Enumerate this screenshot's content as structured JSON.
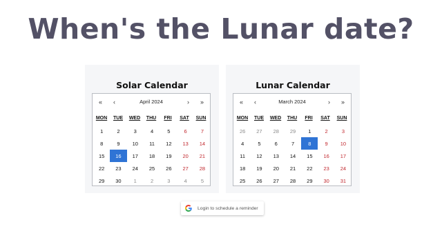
{
  "page": {
    "title": "When's the Lunar date?"
  },
  "solar": {
    "title": "Solar Calendar",
    "month_label": "April 2024",
    "nav": [
      "«",
      "‹",
      "›",
      "»"
    ],
    "weekdays": [
      "MON",
      "TUE",
      "WED",
      "THU",
      "FRI",
      "SAT",
      "SUN"
    ],
    "days": [
      {
        "t": "1",
        "s": ""
      },
      {
        "t": "2",
        "s": ""
      },
      {
        "t": "3",
        "s": ""
      },
      {
        "t": "4",
        "s": ""
      },
      {
        "t": "5",
        "s": ""
      },
      {
        "t": "6",
        "s": "we"
      },
      {
        "t": "7",
        "s": "we"
      },
      {
        "t": "8",
        "s": ""
      },
      {
        "t": "9",
        "s": ""
      },
      {
        "t": "10",
        "s": ""
      },
      {
        "t": "11",
        "s": ""
      },
      {
        "t": "12",
        "s": ""
      },
      {
        "t": "13",
        "s": "we"
      },
      {
        "t": "14",
        "s": "we"
      },
      {
        "t": "15",
        "s": ""
      },
      {
        "t": "16",
        "s": "today"
      },
      {
        "t": "17",
        "s": ""
      },
      {
        "t": "18",
        "s": ""
      },
      {
        "t": "19",
        "s": ""
      },
      {
        "t": "20",
        "s": "we"
      },
      {
        "t": "21",
        "s": "we"
      },
      {
        "t": "22",
        "s": ""
      },
      {
        "t": "23",
        "s": ""
      },
      {
        "t": "24",
        "s": ""
      },
      {
        "t": "25",
        "s": ""
      },
      {
        "t": "26",
        "s": ""
      },
      {
        "t": "27",
        "s": "we"
      },
      {
        "t": "28",
        "s": "we"
      },
      {
        "t": "29",
        "s": ""
      },
      {
        "t": "30",
        "s": ""
      },
      {
        "t": "1",
        "s": "out"
      },
      {
        "t": "2",
        "s": "out"
      },
      {
        "t": "3",
        "s": "out"
      },
      {
        "t": "4",
        "s": "out"
      },
      {
        "t": "5",
        "s": "out"
      }
    ]
  },
  "lunar": {
    "title": "Lunar Calendar",
    "month_label": "March 2024",
    "nav": [
      "«",
      "‹",
      "›",
      "»"
    ],
    "weekdays": [
      "MON",
      "TUE",
      "WED",
      "THU",
      "FRI",
      "SAT",
      "SUN"
    ],
    "days": [
      {
        "t": "26",
        "s": "out"
      },
      {
        "t": "27",
        "s": "out"
      },
      {
        "t": "28",
        "s": "out"
      },
      {
        "t": "29",
        "s": "out"
      },
      {
        "t": "1",
        "s": ""
      },
      {
        "t": "2",
        "s": "we"
      },
      {
        "t": "3",
        "s": "we"
      },
      {
        "t": "4",
        "s": ""
      },
      {
        "t": "5",
        "s": ""
      },
      {
        "t": "6",
        "s": ""
      },
      {
        "t": "7",
        "s": ""
      },
      {
        "t": "8",
        "s": "today"
      },
      {
        "t": "9",
        "s": "we"
      },
      {
        "t": "10",
        "s": "we"
      },
      {
        "t": "11",
        "s": ""
      },
      {
        "t": "12",
        "s": ""
      },
      {
        "t": "13",
        "s": ""
      },
      {
        "t": "14",
        "s": ""
      },
      {
        "t": "15",
        "s": ""
      },
      {
        "t": "16",
        "s": "we"
      },
      {
        "t": "17",
        "s": "we"
      },
      {
        "t": "18",
        "s": ""
      },
      {
        "t": "19",
        "s": ""
      },
      {
        "t": "20",
        "s": ""
      },
      {
        "t": "21",
        "s": ""
      },
      {
        "t": "22",
        "s": ""
      },
      {
        "t": "23",
        "s": "we"
      },
      {
        "t": "24",
        "s": "we"
      },
      {
        "t": "25",
        "s": ""
      },
      {
        "t": "26",
        "s": ""
      },
      {
        "t": "27",
        "s": ""
      },
      {
        "t": "28",
        "s": ""
      },
      {
        "t": "29",
        "s": ""
      },
      {
        "t": "30",
        "s": "we"
      },
      {
        "t": "31",
        "s": "we"
      }
    ]
  },
  "login": {
    "label": "Login to schedule a reminder",
    "icon": "google-icon"
  },
  "colors": {
    "title": "#535166",
    "weekend": "#c1272d",
    "selected": "#2f74d5",
    "panel_bg": "#f5f6f8"
  }
}
